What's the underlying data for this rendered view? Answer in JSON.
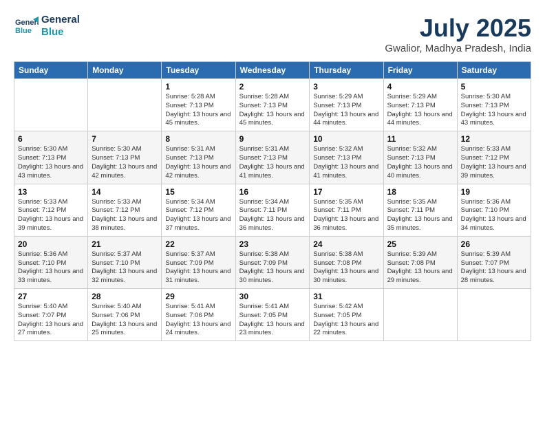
{
  "header": {
    "logo_line1": "General",
    "logo_line2": "Blue",
    "month_year": "July 2025",
    "location": "Gwalior, Madhya Pradesh, India"
  },
  "days_of_week": [
    "Sunday",
    "Monday",
    "Tuesday",
    "Wednesday",
    "Thursday",
    "Friday",
    "Saturday"
  ],
  "weeks": [
    [
      {
        "day": "",
        "info": ""
      },
      {
        "day": "",
        "info": ""
      },
      {
        "day": "1",
        "info": "Sunrise: 5:28 AM\nSunset: 7:13 PM\nDaylight: 13 hours and 45 minutes."
      },
      {
        "day": "2",
        "info": "Sunrise: 5:28 AM\nSunset: 7:13 PM\nDaylight: 13 hours and 45 minutes."
      },
      {
        "day": "3",
        "info": "Sunrise: 5:29 AM\nSunset: 7:13 PM\nDaylight: 13 hours and 44 minutes."
      },
      {
        "day": "4",
        "info": "Sunrise: 5:29 AM\nSunset: 7:13 PM\nDaylight: 13 hours and 44 minutes."
      },
      {
        "day": "5",
        "info": "Sunrise: 5:30 AM\nSunset: 7:13 PM\nDaylight: 13 hours and 43 minutes."
      }
    ],
    [
      {
        "day": "6",
        "info": "Sunrise: 5:30 AM\nSunset: 7:13 PM\nDaylight: 13 hours and 43 minutes."
      },
      {
        "day": "7",
        "info": "Sunrise: 5:30 AM\nSunset: 7:13 PM\nDaylight: 13 hours and 42 minutes."
      },
      {
        "day": "8",
        "info": "Sunrise: 5:31 AM\nSunset: 7:13 PM\nDaylight: 13 hours and 42 minutes."
      },
      {
        "day": "9",
        "info": "Sunrise: 5:31 AM\nSunset: 7:13 PM\nDaylight: 13 hours and 41 minutes."
      },
      {
        "day": "10",
        "info": "Sunrise: 5:32 AM\nSunset: 7:13 PM\nDaylight: 13 hours and 41 minutes."
      },
      {
        "day": "11",
        "info": "Sunrise: 5:32 AM\nSunset: 7:13 PM\nDaylight: 13 hours and 40 minutes."
      },
      {
        "day": "12",
        "info": "Sunrise: 5:33 AM\nSunset: 7:12 PM\nDaylight: 13 hours and 39 minutes."
      }
    ],
    [
      {
        "day": "13",
        "info": "Sunrise: 5:33 AM\nSunset: 7:12 PM\nDaylight: 13 hours and 39 minutes."
      },
      {
        "day": "14",
        "info": "Sunrise: 5:33 AM\nSunset: 7:12 PM\nDaylight: 13 hours and 38 minutes."
      },
      {
        "day": "15",
        "info": "Sunrise: 5:34 AM\nSunset: 7:12 PM\nDaylight: 13 hours and 37 minutes."
      },
      {
        "day": "16",
        "info": "Sunrise: 5:34 AM\nSunset: 7:11 PM\nDaylight: 13 hours and 36 minutes."
      },
      {
        "day": "17",
        "info": "Sunrise: 5:35 AM\nSunset: 7:11 PM\nDaylight: 13 hours and 36 minutes."
      },
      {
        "day": "18",
        "info": "Sunrise: 5:35 AM\nSunset: 7:11 PM\nDaylight: 13 hours and 35 minutes."
      },
      {
        "day": "19",
        "info": "Sunrise: 5:36 AM\nSunset: 7:10 PM\nDaylight: 13 hours and 34 minutes."
      }
    ],
    [
      {
        "day": "20",
        "info": "Sunrise: 5:36 AM\nSunset: 7:10 PM\nDaylight: 13 hours and 33 minutes."
      },
      {
        "day": "21",
        "info": "Sunrise: 5:37 AM\nSunset: 7:10 PM\nDaylight: 13 hours and 32 minutes."
      },
      {
        "day": "22",
        "info": "Sunrise: 5:37 AM\nSunset: 7:09 PM\nDaylight: 13 hours and 31 minutes."
      },
      {
        "day": "23",
        "info": "Sunrise: 5:38 AM\nSunset: 7:09 PM\nDaylight: 13 hours and 30 minutes."
      },
      {
        "day": "24",
        "info": "Sunrise: 5:38 AM\nSunset: 7:08 PM\nDaylight: 13 hours and 30 minutes."
      },
      {
        "day": "25",
        "info": "Sunrise: 5:39 AM\nSunset: 7:08 PM\nDaylight: 13 hours and 29 minutes."
      },
      {
        "day": "26",
        "info": "Sunrise: 5:39 AM\nSunset: 7:07 PM\nDaylight: 13 hours and 28 minutes."
      }
    ],
    [
      {
        "day": "27",
        "info": "Sunrise: 5:40 AM\nSunset: 7:07 PM\nDaylight: 13 hours and 27 minutes."
      },
      {
        "day": "28",
        "info": "Sunrise: 5:40 AM\nSunset: 7:06 PM\nDaylight: 13 hours and 25 minutes."
      },
      {
        "day": "29",
        "info": "Sunrise: 5:41 AM\nSunset: 7:06 PM\nDaylight: 13 hours and 24 minutes."
      },
      {
        "day": "30",
        "info": "Sunrise: 5:41 AM\nSunset: 7:05 PM\nDaylight: 13 hours and 23 minutes."
      },
      {
        "day": "31",
        "info": "Sunrise: 5:42 AM\nSunset: 7:05 PM\nDaylight: 13 hours and 22 minutes."
      },
      {
        "day": "",
        "info": ""
      },
      {
        "day": "",
        "info": ""
      }
    ]
  ]
}
